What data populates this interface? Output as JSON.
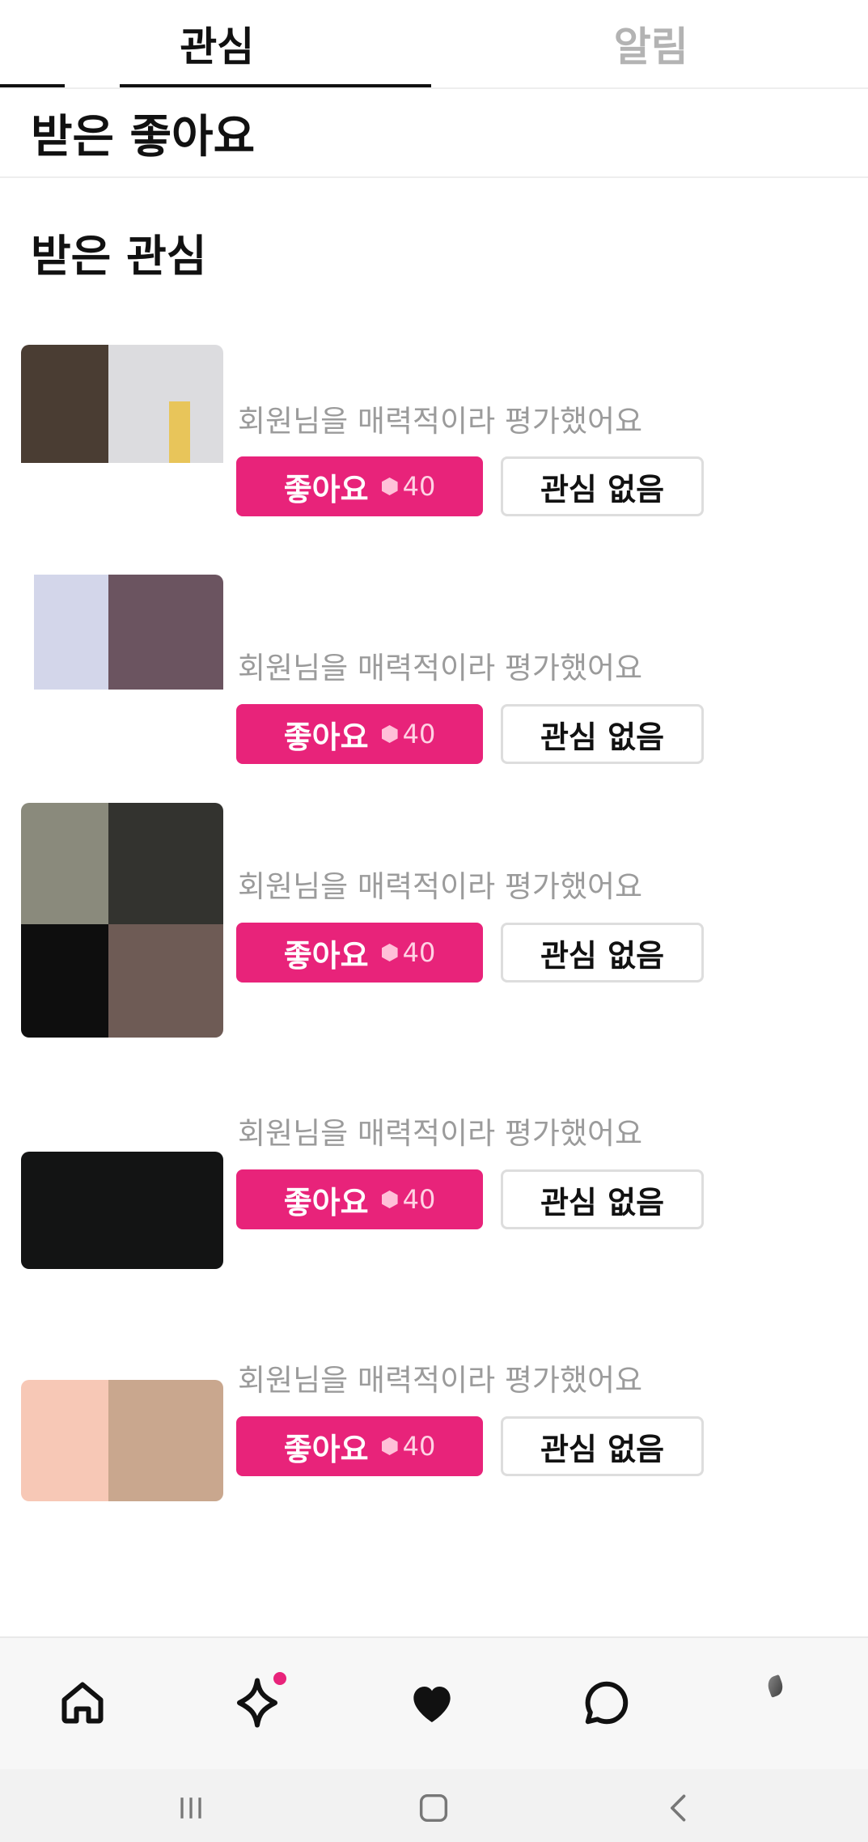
{
  "tabs": [
    {
      "label": "관심",
      "active": true
    },
    {
      "label": "알림",
      "active": false
    }
  ],
  "subheader": {
    "label": "받은 좋아요"
  },
  "section": {
    "title": "받은 관심"
  },
  "items": [
    {
      "message": "회원님을 매력적이라 평가했어요",
      "like_label": "좋아요",
      "cost": "40",
      "dismiss_label": "관심 없음"
    },
    {
      "message": "회원님을 매력적이라 평가했어요",
      "like_label": "좋아요",
      "cost": "40",
      "dismiss_label": "관심 없음"
    },
    {
      "message": "회원님을 매력적이라 평가했어요",
      "like_label": "좋아요",
      "cost": "40",
      "dismiss_label": "관심 없음"
    },
    {
      "message": "회원님을 매력적이라 평가했어요",
      "like_label": "좋아요",
      "cost": "40",
      "dismiss_label": "관심 없음"
    },
    {
      "message": "회원님을 매력적이라 평가했어요",
      "like_label": "좋아요",
      "cost": "40",
      "dismiss_label": "관심 없음"
    }
  ],
  "bottom_nav": [
    {
      "icon": "home-icon"
    },
    {
      "icon": "sparkle-icon",
      "badge": true
    },
    {
      "icon": "heart-icon"
    },
    {
      "icon": "chat-icon"
    },
    {
      "icon": "profile-icon"
    }
  ],
  "system_nav": [
    {
      "icon": "recent-apps-icon"
    },
    {
      "icon": "home-square-icon"
    },
    {
      "icon": "back-icon"
    }
  ],
  "colors": {
    "accent": "#e8237a",
    "inactive_tab": "#b3b3b3",
    "message": "#9b9b9b"
  }
}
